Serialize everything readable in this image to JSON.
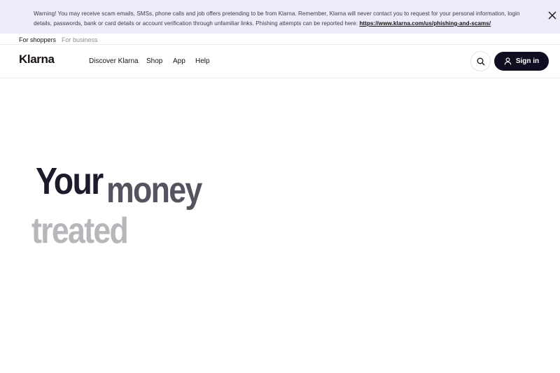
{
  "banner": {
    "text": "Warning! You may receive scam emails, SMSs, phone calls and job offers pretending to be from Klarna. Remember, Klarna will never contact you to request for your personal information, login details, passwords, bank or card details or account verification through unfamiliar links. Phishing attempts can be reported here: ",
    "link": "https://www.klarna.com/us/phishing-and-scams/",
    "close_icon": "close-icon"
  },
  "audience": {
    "shoppers": "For shoppers",
    "business": "For business"
  },
  "header": {
    "logo": "Klarna",
    "nav": [
      "Discover Klarna",
      "Shop",
      "App",
      "Help"
    ],
    "search_icon": "search-icon",
    "signin_label": "Sign in",
    "signin_icon": "user-icon"
  },
  "hero": {
    "word1": "Your",
    "word2": "money",
    "word3": "treated"
  },
  "colors": {
    "banner_bg": "#ecebfa",
    "signin_bg": "#0f0d20",
    "hero_dark": "#1d1a2c",
    "hero_mid": "#565360",
    "hero_light": "#b7b6ba"
  }
}
